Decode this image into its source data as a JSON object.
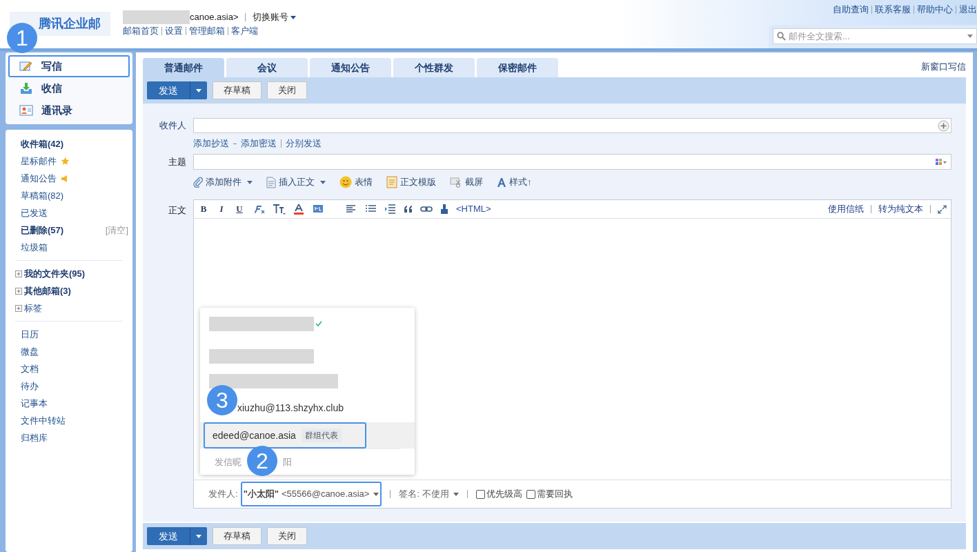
{
  "header": {
    "logo": "腾讯企业邮",
    "account": "canoe.asia>",
    "switch_account": "切换账号",
    "nav_links": [
      "邮箱首页",
      "设置",
      "管理邮箱",
      "客户端"
    ],
    "top_links": [
      "自助查询",
      "联系客服",
      "帮助中心",
      "退出"
    ],
    "search": {
      "placeholder": "邮件全文搜索..."
    }
  },
  "sidebar": {
    "actions": [
      {
        "label": "写信",
        "kind": "compose",
        "selected": true
      },
      {
        "label": "收信",
        "kind": "inbox",
        "selected": false
      },
      {
        "label": "通讯录",
        "kind": "contacts",
        "selected": false
      }
    ],
    "folders": [
      {
        "label": "收件箱(42)",
        "bold": true,
        "kind": "plain"
      },
      {
        "label": "星标邮件",
        "bold": false,
        "kind": "star"
      },
      {
        "label": "通知公告",
        "bold": false,
        "kind": "notice"
      },
      {
        "label": "草稿箱(82)",
        "bold": false,
        "kind": "plain"
      },
      {
        "label": "已发送",
        "bold": false,
        "kind": "plain"
      },
      {
        "label": "已删除(57)",
        "bold": true,
        "kind": "plain",
        "action": "[清空]"
      },
      {
        "label": "垃圾箱",
        "bold": false,
        "kind": "plain"
      }
    ],
    "groups": [
      {
        "label": "我的文件夹(95)",
        "bold": true,
        "expanded": false
      },
      {
        "label": "其他邮箱(3)",
        "bold": true,
        "expanded": false
      },
      {
        "label": "标签",
        "bold": false,
        "expanded": false
      }
    ],
    "apps": [
      "日历",
      "微盘",
      "文档",
      "待办",
      "记事本",
      "文件中转站",
      "归档库"
    ]
  },
  "tabs": [
    {
      "label": "普通邮件",
      "selected": true
    },
    {
      "label": "会议",
      "selected": false
    },
    {
      "label": "通知公告",
      "selected": false
    },
    {
      "label": "个性群发",
      "selected": false
    },
    {
      "label": "保密邮件",
      "selected": false
    }
  ],
  "new_window": "新窗口写信",
  "toolbar": {
    "send": "发送",
    "draft": "存草稿",
    "close": "关闭"
  },
  "form": {
    "to_label": "收件人",
    "recipient_links": [
      "添加抄送",
      "添加密送",
      "分别发送"
    ],
    "subject_label": "主题",
    "attach_tools": [
      {
        "label": "添加附件",
        "kind": "attach",
        "dropdown": true
      },
      {
        "label": "插入正文",
        "kind": "document",
        "dropdown": true
      },
      {
        "label": "表情",
        "kind": "emoji",
        "dropdown": false
      },
      {
        "label": "正文模版",
        "kind": "template",
        "dropdown": false
      },
      {
        "label": "截屏",
        "kind": "screenshot",
        "dropdown": false
      },
      {
        "label": "样式↑",
        "kind": "style",
        "dropdown": false
      }
    ],
    "body_label": "正文",
    "format_letters": [
      "B",
      "I",
      "U"
    ],
    "html_toggle": "<HTML>",
    "editor_links": [
      "使用信纸",
      "转为纯文本"
    ]
  },
  "sender": {
    "label": "发件人:",
    "name": "\"小太阳\"",
    "address": "<55566@canoe.asia>",
    "signature_label": "签名:",
    "signature_value": "不使用",
    "options": [
      {
        "label": "优先级高",
        "checked": false
      },
      {
        "label": "需要回执",
        "checked": false
      }
    ]
  },
  "sender_menu": {
    "items": [
      {
        "kind": "redacted",
        "verified": true,
        "selected": false
      },
      {
        "kind": "redacted",
        "verified": false,
        "selected": false
      },
      {
        "kind": "redacted",
        "verified": false,
        "selected": false
      },
      {
        "kind": "address",
        "text": "xiuzhu@113.shzyhx.club",
        "selected": false
      },
      {
        "kind": "address",
        "text": "edeed@canoe.asia",
        "tag": "群组代表",
        "selected": true
      }
    ],
    "nickname_parts": [
      "发信昵",
      "阳"
    ]
  },
  "bottom_toolbar": {
    "send": "发送",
    "draft": "存草稿",
    "close": "关闭"
  },
  "annotations": [
    {
      "number": "1"
    },
    {
      "number": "2"
    },
    {
      "number": "3"
    }
  ]
}
